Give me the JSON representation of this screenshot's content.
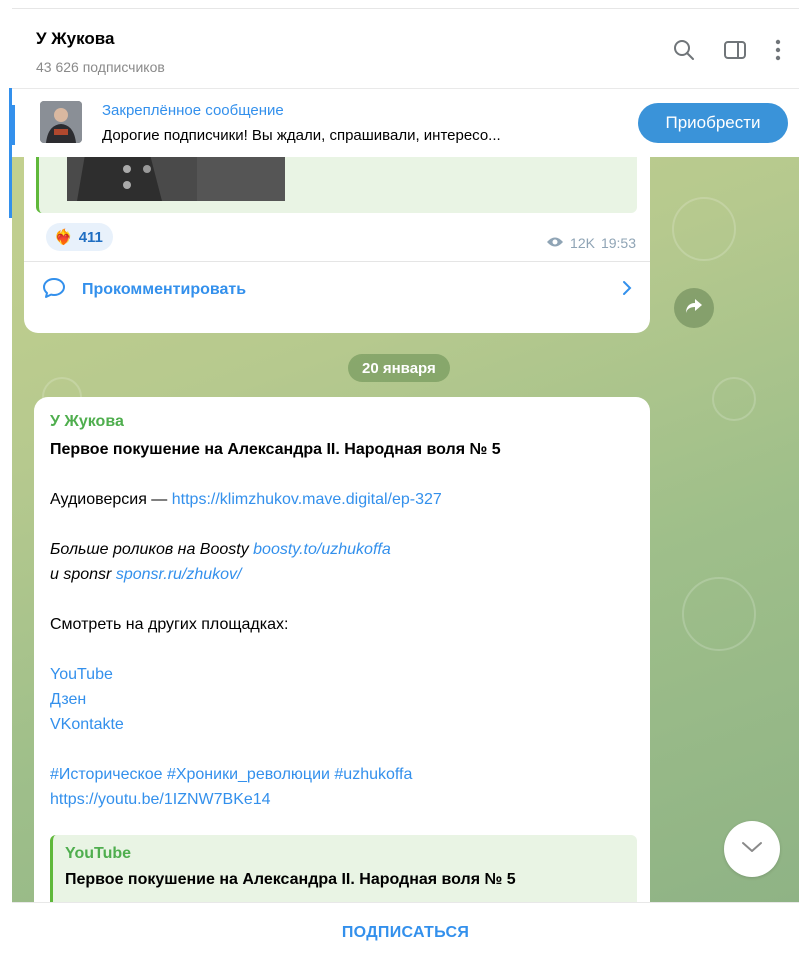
{
  "channel": {
    "title": "У Жукова",
    "subscribers": "43 626 подписчиков"
  },
  "header_icons": [
    "search-icon",
    "sidebar-toggle-icon",
    "more-vertical-icon"
  ],
  "pinned": {
    "title": "Закреплённое сообщение",
    "text": "Дорогие подписчики! Вы ждали, спрашивали, интересо...",
    "button": "Приобрести"
  },
  "message1": {
    "reaction_emoji": "❤️‍🔥",
    "reaction_count": "411",
    "views": "12K",
    "time": "19:53",
    "comment_label": "Прокомментировать"
  },
  "date_separator": "20 января",
  "message2": {
    "author": "У Жукова",
    "title": "Первое покушение на Александра II. Народная воля № 5",
    "audio_prefix": "Аудиоверсия — ",
    "audio_link": "https://klimzhukov.mave.digital/ep-327",
    "boosty_text": "Больше роликов на Boosty ",
    "boosty_link": "boosty.to/uzhukoffa",
    "sponsr_text": "и sponsr ",
    "sponsr_link": "sponsr.ru/zhukov/",
    "platforms_heading": "Смотреть на других площадках:",
    "platforms": [
      "YouTube",
      "Дзен",
      "VKontakte"
    ],
    "hashtags": "#Историческое #Хроники_революции #uzhukoffa",
    "video_link": "https://youtu.be/1IZNW7BKe14",
    "preview_site": "YouTube",
    "preview_title": "Первое покушение на Александра II. Народная воля № 5"
  },
  "footer": {
    "subscribe": "ПОДПИСАТЬСЯ"
  },
  "colors": {
    "accent": "#3390ec",
    "author": "#4fae4e",
    "button": "#3a93d9"
  }
}
